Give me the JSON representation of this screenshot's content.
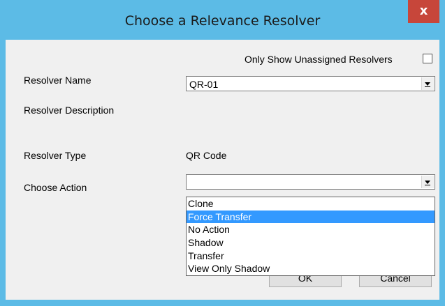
{
  "window": {
    "title": "Choose a Relevance Resolver",
    "close_label": "x"
  },
  "filter": {
    "only_unassigned_label": "Only Show Unassigned Resolvers",
    "only_unassigned_checked": false
  },
  "fields": {
    "resolver_name_label": "Resolver Name",
    "resolver_name_value": "QR-01",
    "resolver_description_label": "Resolver Description",
    "resolver_description_value": "",
    "resolver_type_label": "Resolver Type",
    "resolver_type_value": "QR Code",
    "choose_action_label": "Choose Action",
    "choose_action_value": ""
  },
  "action_options": [
    "Clone",
    "Force Transfer",
    "No Action",
    "Shadow",
    "Transfer",
    "View Only Shadow"
  ],
  "highlighted_option": "Force Transfer",
  "buttons": {
    "ok_label": "OK",
    "cancel_label": "Cancel"
  },
  "colors": {
    "title_bar": "#5cbbe6",
    "close_button": "#c7463a",
    "selection": "#3399ff",
    "dialog_body": "#f0f0f0"
  }
}
